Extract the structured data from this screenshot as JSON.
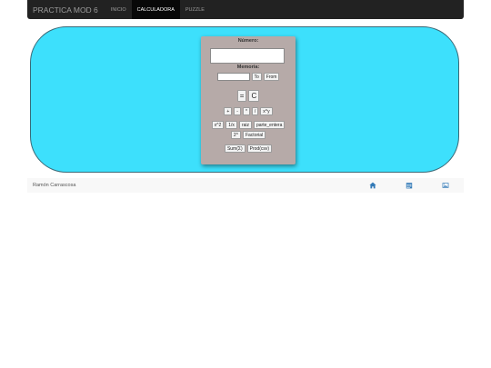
{
  "navbar": {
    "brand": "PRACTICA MOD 6",
    "items": [
      {
        "label": "INICIO",
        "active": false
      },
      {
        "label": "CALCULADORA",
        "active": true
      },
      {
        "label": "PUZZLE",
        "active": false
      }
    ]
  },
  "calculator": {
    "numero_label": "Número:",
    "numero_value": "",
    "memoria_label": "Memoria:",
    "memoria_value": "",
    "to_label": "To",
    "from_label": "From",
    "equals_label": "=",
    "clear_label": "C",
    "add_label": "+",
    "sub_label": "-",
    "mul_label": "*",
    "div_label": "/",
    "pow_label": "x^y",
    "square_label": "x^2",
    "inverse_label": "1/x",
    "sqrt_label": "raiz",
    "int_label": "parte_entera",
    "pow2_label": "2^",
    "factorial_label": "Factorial",
    "sum_label": "Sum(Σ)",
    "prod_label": "Prod(csv)"
  },
  "footer": {
    "author": "Ramón Carrascosa",
    "icons": [
      "home-icon",
      "calendar-icon",
      "image-icon"
    ]
  },
  "colors": {
    "navbar_bg": "#222222",
    "stage_bg": "#3de0fc",
    "calc_bg": "#b6aaa8",
    "icon_blue": "#337ab7"
  }
}
